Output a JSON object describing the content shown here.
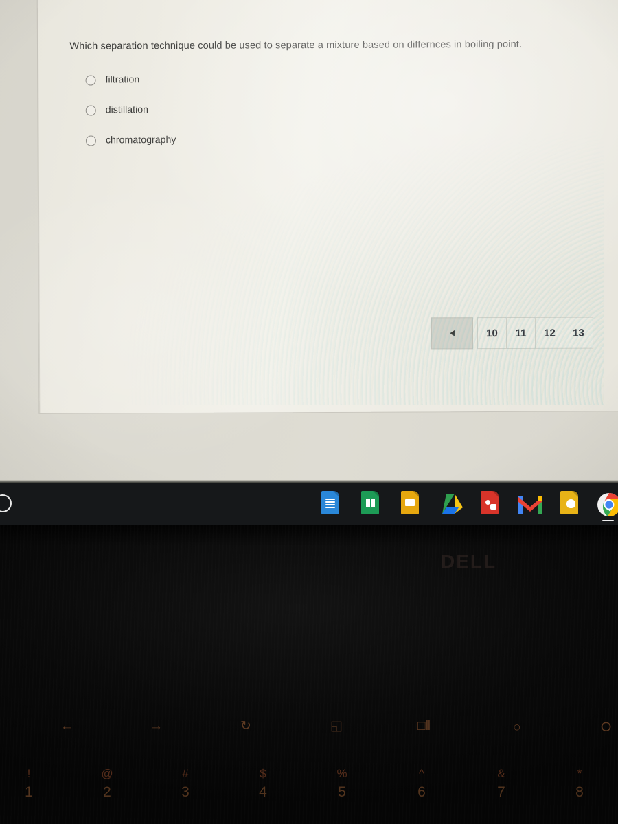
{
  "quiz": {
    "question": "Which separation technique could be used to separate a mixture based on differnces in boiling point.",
    "options": [
      {
        "label": "filtration",
        "selected": false
      },
      {
        "label": "distillation",
        "selected": false
      },
      {
        "label": "chromatography",
        "selected": false
      }
    ]
  },
  "pagination": {
    "prev_icon": "triangle-left-icon",
    "pages": [
      "10",
      "11",
      "12",
      "13"
    ]
  },
  "shelf": {
    "launcher_icon": "launcher-circle-icon",
    "apps": [
      {
        "name": "google-docs",
        "icon": "docs-icon",
        "color": "#2a87d8",
        "active": false
      },
      {
        "name": "google-sheets",
        "icon": "sheets-icon",
        "color": "#1d9b56",
        "active": false
      },
      {
        "name": "google-slides",
        "icon": "slides-icon",
        "color": "#e6a70f",
        "active": false
      },
      {
        "name": "google-drive",
        "icon": "drive-icon",
        "color": "#ffc107",
        "active": false
      },
      {
        "name": "red-document",
        "icon": "red-doc-icon",
        "color": "#d8342a",
        "active": false
      },
      {
        "name": "gmail",
        "icon": "gmail-icon",
        "color": "#e04134",
        "active": false
      },
      {
        "name": "google-keep",
        "icon": "keep-icon",
        "color": "#e8b317",
        "active": false
      },
      {
        "name": "google-chrome",
        "icon": "chrome-icon",
        "color": "#4285f4",
        "active": true
      }
    ]
  },
  "laptop": {
    "brand": "DELL",
    "function_keys": [
      {
        "name": "back-key",
        "glyph": "←"
      },
      {
        "name": "forward-key",
        "glyph": "→"
      },
      {
        "name": "reload-key",
        "glyph": "↻"
      },
      {
        "name": "fullscreen-key",
        "glyph": "◱"
      },
      {
        "name": "overview-key",
        "glyph": "□‖"
      },
      {
        "name": "brightness-down-key",
        "glyph": "○"
      },
      {
        "name": "brightness-up-key",
        "glyph": "⭘"
      }
    ],
    "number_keys": [
      {
        "symbol": "!",
        "digit": "1"
      },
      {
        "symbol": "@",
        "digit": "2"
      },
      {
        "symbol": "#",
        "digit": "3"
      },
      {
        "symbol": "$",
        "digit": "4"
      },
      {
        "symbol": "%",
        "digit": "5"
      },
      {
        "symbol": "^",
        "digit": "6"
      },
      {
        "symbol": "&",
        "digit": "7"
      },
      {
        "symbol": "*",
        "digit": "8"
      }
    ]
  }
}
